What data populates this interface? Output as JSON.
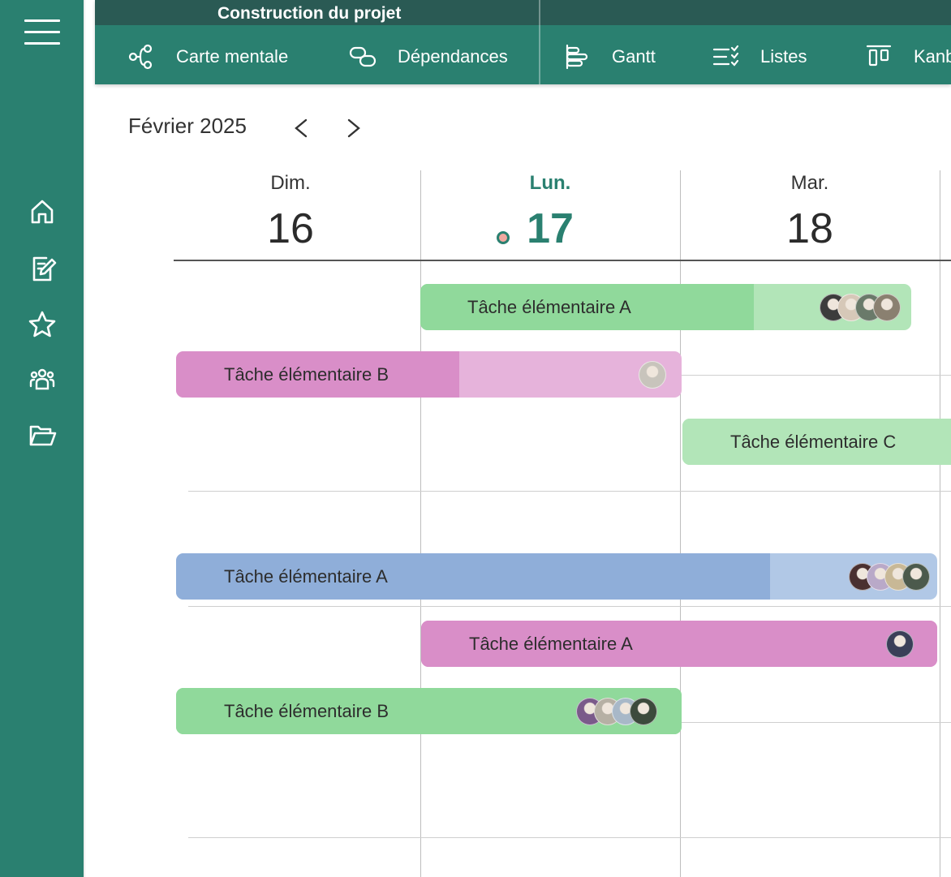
{
  "app": {
    "project_title": "Construction du projet",
    "colors": {
      "primary": "#2a8070",
      "title_strip": "#2a5a54",
      "today": "#2a8070"
    }
  },
  "sidebar": {
    "menu_icon": "hamburger-menu-icon",
    "items": [
      {
        "icon": "home-icon"
      },
      {
        "icon": "edit-note-icon"
      },
      {
        "icon": "star-icon"
      },
      {
        "icon": "team-icon"
      },
      {
        "icon": "folder-open-icon"
      }
    ]
  },
  "views": [
    {
      "label": "Carte mentale",
      "icon": "mind-map-icon"
    },
    {
      "label": "Dépendances",
      "icon": "dependencies-icon"
    },
    {
      "label": "Gantt",
      "icon": "gantt-icon"
    },
    {
      "label": "Listes",
      "icon": "checklist-icon"
    },
    {
      "label": "Kanb",
      "icon": "kanban-icon"
    }
  ],
  "calendar": {
    "month": "Février 2025",
    "prev_icon": "chevron-left-icon",
    "next_icon": "chevron-right-icon",
    "days": [
      {
        "name": "Dim.",
        "num": "16",
        "today": false
      },
      {
        "name": "Lun.",
        "num": "17",
        "today": true
      },
      {
        "name": "Mar.",
        "num": "18",
        "today": false
      }
    ]
  },
  "tasks": [
    {
      "label": "Tâche élémentaire A",
      "color": "#90d99b",
      "light": "#b2e5b8",
      "progress": 0.68,
      "avatars": [
        "#3c3c3c",
        "#d6c8b8",
        "#6a7a6a",
        "#8a8070"
      ]
    },
    {
      "label": "Tâche élémentaire B",
      "color": "#d98ec8",
      "light": "#e6b3db",
      "progress": 0.56,
      "avatars": [
        "#c8c4bc"
      ]
    },
    {
      "label": "Tâche élémentaire C",
      "color": "#b2e5b8",
      "light": "#b2e5b8",
      "progress": 1.0,
      "avatars": []
    },
    {
      "label": "Tâche élémentaire A",
      "color": "#8faed9",
      "light": "#b1c8e6",
      "progress": 0.78,
      "avatars": [
        "#4a3030",
        "#b9a9c8",
        "#c8b896",
        "#4c5a4c"
      ]
    },
    {
      "label": "Tâche élémentaire A",
      "color": "#d98ec8",
      "light": "#d98ec8",
      "progress": 1.0,
      "avatars": [
        "#3a3f58"
      ]
    },
    {
      "label": "Tâche élémentaire B",
      "color": "#90d99b",
      "light": "#90d99b",
      "progress": 1.0,
      "avatars": [
        "#7a5a8a",
        "#b6b0a4",
        "#a8b8c8",
        "#3c4a3c"
      ]
    }
  ]
}
